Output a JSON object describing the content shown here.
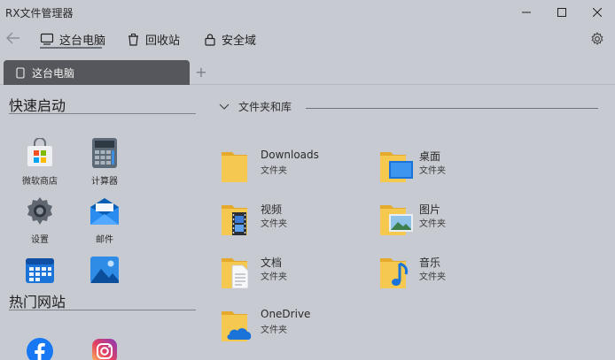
{
  "window": {
    "title": "RX文件管理器"
  },
  "nav": {
    "tabs": [
      {
        "label": "这台电脑",
        "icon": "computer-icon"
      },
      {
        "label": "回收站",
        "icon": "recycle-bin-icon"
      },
      {
        "label": "安全域",
        "icon": "lock-icon"
      }
    ]
  },
  "tabs": {
    "open": [
      {
        "label": "这台电脑",
        "icon": "device-icon"
      }
    ],
    "new_tab": "+"
  },
  "sidebar": {
    "quick_launch": {
      "title": "快速启动",
      "apps": [
        {
          "label": "微软商店",
          "icon": "store-icon"
        },
        {
          "label": "计算器",
          "icon": "calculator-icon"
        },
        {
          "label": "设置",
          "icon": "settings-gear-icon"
        },
        {
          "label": "邮件",
          "icon": "mail-icon"
        },
        {
          "label": "",
          "icon": "calendar-icon"
        },
        {
          "label": "",
          "icon": "photos-icon"
        }
      ]
    },
    "popular_sites": {
      "title": "热门网站",
      "sites": [
        {
          "label": "",
          "icon": "facebook-icon"
        },
        {
          "label": "",
          "icon": "instagram-icon"
        }
      ]
    }
  },
  "main": {
    "section_title": "文件夹和库",
    "folders": [
      {
        "name": "Downloads",
        "type": "文件夹",
        "icon": "folder-icon"
      },
      {
        "name": "桌面",
        "type": "文件夹",
        "icon": "desktop-folder-icon"
      },
      {
        "name": "视频",
        "type": "文件夹",
        "icon": "video-folder-icon"
      },
      {
        "name": "图片",
        "type": "文件夹",
        "icon": "pictures-folder-icon"
      },
      {
        "name": "文档",
        "type": "文件夹",
        "icon": "documents-folder-icon"
      },
      {
        "name": "音乐",
        "type": "文件夹",
        "icon": "music-folder-icon"
      },
      {
        "name": "OneDrive",
        "type": "文件夹",
        "icon": "onedrive-folder-icon"
      }
    ]
  },
  "colors": {
    "background": "#c7cbd1",
    "active_tab": "#55575c",
    "folder_yellow": "#f5c94f",
    "accent_blue": "#1a73d8"
  }
}
